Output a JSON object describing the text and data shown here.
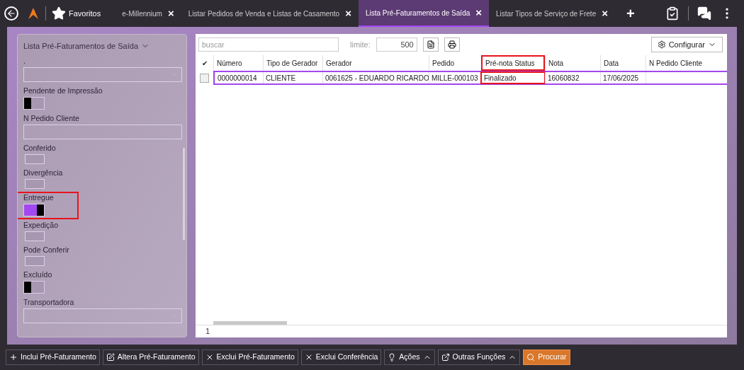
{
  "topbar": {
    "favorites": "Favoritos",
    "tabs": [
      {
        "label": "e-Millennium",
        "selected": false,
        "close": "×"
      },
      {
        "label": "Listar Pedidos de Venda e Listas de Casamento",
        "selected": false,
        "close": "×"
      },
      {
        "label": "Lista Pré-Faturamentos de Saída",
        "selected": true,
        "close": "×"
      },
      {
        "label": "Listar Tipos de Serviço de Frete",
        "selected": false,
        "close": "×"
      }
    ],
    "add": "+"
  },
  "filters": {
    "title": "Lista Pré-Faturamentos de Saída",
    "fields": [
      {
        "kind": "select",
        "label": ".",
        "highlighted": false
      },
      {
        "kind": "toggle",
        "label": "Pendente de Impressão",
        "empty": false,
        "on": false,
        "highlighted": false
      },
      {
        "kind": "text",
        "label": "N Pedido Cliente",
        "highlighted": false
      },
      {
        "kind": "toggle",
        "label": "Conferido",
        "empty": true,
        "highlighted": false
      },
      {
        "kind": "toggle",
        "label": "Divergência",
        "empty": true,
        "highlighted": false
      },
      {
        "kind": "toggle",
        "label": "Entregue",
        "empty": false,
        "on": true,
        "highlighted": true
      },
      {
        "kind": "toggle",
        "label": "Expedição",
        "empty": true,
        "highlighted": false
      },
      {
        "kind": "toggle",
        "label": "Pode Conferir",
        "empty": true,
        "highlighted": false
      },
      {
        "kind": "toggle",
        "label": "Excluído",
        "empty": false,
        "on": false,
        "highlighted": false
      },
      {
        "kind": "select",
        "label": "Transportadora",
        "highlighted": false
      }
    ]
  },
  "toolbar": {
    "search": {
      "placeholder": "buscar"
    },
    "limit_label": "limite:",
    "limit": "500",
    "configure": "Configurar"
  },
  "table": {
    "check_header": "✔",
    "columns": [
      {
        "label": "Número",
        "highlighted": false
      },
      {
        "label": "Tipo de Gerador",
        "highlighted": false
      },
      {
        "label": "Gerador",
        "highlighted": false
      },
      {
        "label": "Pedido",
        "highlighted": false
      },
      {
        "label": "Pré-nota Status",
        "highlighted": true
      },
      {
        "label": "Nota",
        "highlighted": false
      },
      {
        "label": "Data",
        "highlighted": false
      },
      {
        "label": "N Pedido Cliente",
        "highlighted": false
      }
    ],
    "rows": [
      {
        "selected": true,
        "checked": false,
        "cells": [
          "0000000014",
          "CLIENTE",
          "0061625 - EDUARDO RICARDO",
          "MILLE-000103",
          "Finalizado",
          "16060832",
          "17/06/2025",
          ""
        ]
      }
    ],
    "footer": "1"
  },
  "actions": [
    {
      "kind": "plus",
      "label": "Inclui Pré-Faturamento"
    },
    {
      "kind": "edit",
      "label": "Altera Pré-Faturamento"
    },
    {
      "kind": "x",
      "label": "Exclui Pré-Faturamento"
    },
    {
      "kind": "x",
      "label": "Exclui Conferência"
    },
    {
      "kind": "bulb",
      "label": "Ações",
      "menu": true
    },
    {
      "kind": "external",
      "label": "Outras Funções",
      "menu": true
    },
    {
      "kind": "search",
      "label": "Procurar",
      "primary": true
    }
  ]
}
